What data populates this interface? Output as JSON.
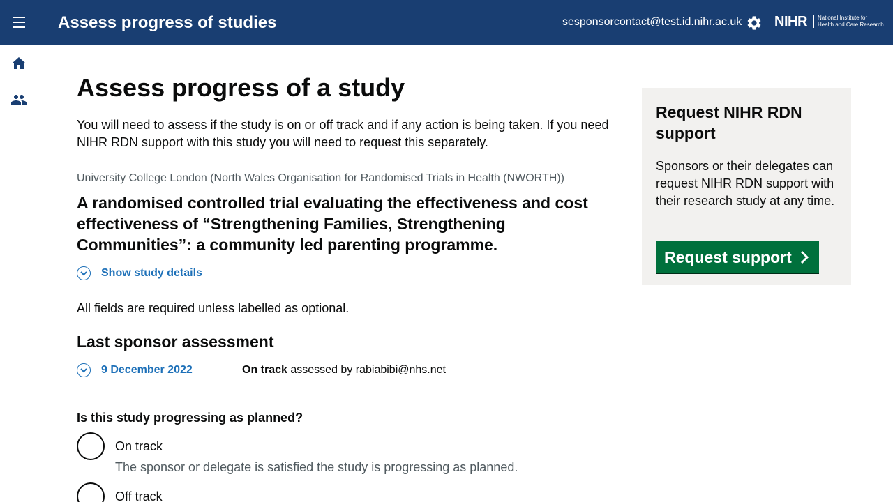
{
  "header": {
    "title": "Assess progress of studies",
    "user_email": "sesponsorcontact@test.id.nihr.ac.uk",
    "logo": {
      "name": "NIHR",
      "subtitle_line1": "National Institute for",
      "subtitle_line2": "Health and Care Research"
    },
    "menu_icon": "hamburger-menu-icon",
    "settings_icon": "gear-icon"
  },
  "sidenav": {
    "items": [
      {
        "icon": "home-icon"
      },
      {
        "icon": "users-icon"
      }
    ]
  },
  "main": {
    "title": "Assess progress of a study",
    "intro": "You will need to assess if the study is on or off track and if any action is being taken. If you need NIHR RDN support with this study you will need to request this separately.",
    "organisation": "University College London (North Wales Organisation for Randomised Trials in Health (NWORTH))",
    "study_title": "A randomised controlled trial evaluating the effectiveness and cost effectiveness of “Strengthening Families, Strengthening Communities”: a community led parenting programme.",
    "details_toggle_label": "Show study details",
    "required_note": "All fields are required unless labelled as optional.",
    "last_assessment": {
      "heading": "Last sponsor assessment",
      "date": "9 December 2022",
      "status": "On track",
      "assessed_by_text": "assessed by rabiabibi@nhs.net"
    },
    "question": "Is this study progressing as planned?",
    "options": [
      {
        "label": "On track",
        "hint": "The sponsor or delegate is satisfied the study is progressing as planned."
      },
      {
        "label": "Off track",
        "hint": ""
      }
    ]
  },
  "panel": {
    "title": "Request NIHR RDN support",
    "body": "Sponsors or their delegates can request NIHR RDN support with their research study at any time.",
    "button_label": "Request support"
  },
  "colors": {
    "header_bg": "#193e72",
    "link_blue": "#1d70b8",
    "button_green": "#00703c",
    "panel_bg": "#f2f1ef"
  }
}
